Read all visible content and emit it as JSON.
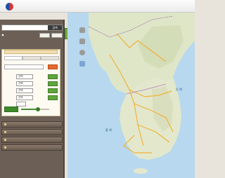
{
  "header": {
    "site_name": ""
  },
  "search": {
    "value": "",
    "button_label": "검색"
  },
  "options": {
    "checkbox_label": "",
    "button_1": "",
    "button_2": ""
  },
  "advanced": {
    "title": "",
    "tabs": [
      "",
      "",
      ""
    ],
    "keyword_placeholder": "",
    "filters": [
      {
        "label": "",
        "select_value": "선택"
      },
      {
        "label": "",
        "select_value": "선택"
      },
      {
        "label": "",
        "select_value": "선택"
      },
      {
        "label": "",
        "select_value": "선택"
      },
      {
        "label": "",
        "select_value": ""
      }
    ],
    "slider_level": 0.6
  },
  "menu": [
    "",
    "",
    "",
    ""
  ],
  "map": {
    "east_sea": "동 해",
    "yellow_sea": "황 해",
    "pyongyang": "",
    "seoul": ""
  },
  "tools": [
    "",
    "",
    "",
    ""
  ],
  "colors": {
    "panel": "#6b5f56",
    "accent_green": "#5ea53b",
    "accent_orange": "#e56a2a",
    "sea": "#b7d8ee",
    "land": "#dfe6c8"
  }
}
